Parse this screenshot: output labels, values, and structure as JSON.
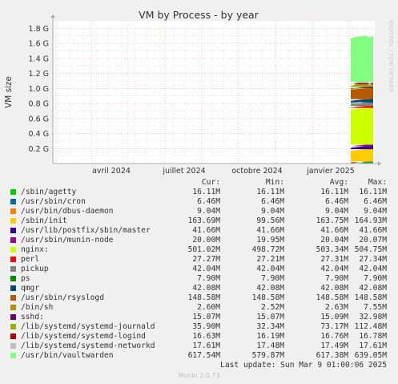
{
  "chart_data": {
    "type": "area",
    "title": "VM by Process - by year",
    "ylabel": "VM size",
    "watermark": "RRDTOOL / TOBI OETIKER",
    "x_ticks": [
      "avril 2024",
      "juillet 2024",
      "octobre 2024",
      "janvier 2025"
    ],
    "y_ticks": [
      "0.2 G",
      "0.4 G",
      "0.6 G",
      "0.8 G",
      "1.0 G",
      "1.2 G",
      "1.4 G",
      "1.6 G",
      "1.8 G"
    ],
    "ylim": [
      0,
      1.9
    ],
    "grid": true,
    "column_headers": [
      "Cur:",
      "Min:",
      "Avg:",
      "Max:"
    ],
    "series": [
      {
        "name": "/sbin/agetty",
        "color": "#00cc00",
        "cur": "16.11M",
        "min": "16.11M",
        "avg": "16.11M",
        "max": "16.11M"
      },
      {
        "name": "/usr/sbin/cron",
        "color": "#0066b3",
        "cur": "6.46M",
        "min": "6.46M",
        "avg": "6.46M",
        "max": "6.46M"
      },
      {
        "name": "/usr/bin/dbus-daemon",
        "color": "#ff8000",
        "cur": "9.04M",
        "min": "9.04M",
        "avg": "9.04M",
        "max": "9.04M"
      },
      {
        "name": "/sbin/init",
        "color": "#ffcc00",
        "cur": "163.69M",
        "min": "99.56M",
        "avg": "163.75M",
        "max": "164.93M"
      },
      {
        "name": "/usr/lib/postfix/sbin/master",
        "color": "#330099",
        "cur": "41.66M",
        "min": "41.66M",
        "avg": "41.66M",
        "max": "41.66M"
      },
      {
        "name": "/usr/sbin/munin-node",
        "color": "#990099",
        "cur": "20.00M",
        "min": "19.95M",
        "avg": "20.04M",
        "max": "20.07M"
      },
      {
        "name": "nginx:",
        "color": "#ccff00",
        "cur": "501.02M",
        "min": "498.72M",
        "avg": "503.34M",
        "max": "504.75M"
      },
      {
        "name": "perl",
        "color": "#ff0000",
        "cur": "27.27M",
        "min": "27.21M",
        "avg": "27.31M",
        "max": "27.34M"
      },
      {
        "name": "pickup",
        "color": "#808080",
        "cur": "42.04M",
        "min": "42.04M",
        "avg": "42.04M",
        "max": "42.04M"
      },
      {
        "name": "ps",
        "color": "#008f00",
        "cur": "7.90M",
        "min": "7.90M",
        "avg": "7.90M",
        "max": "7.90M"
      },
      {
        "name": "qmgr",
        "color": "#00487d",
        "cur": "42.08M",
        "min": "42.08M",
        "avg": "42.08M",
        "max": "42.08M"
      },
      {
        "name": "/usr/sbin/rsyslogd",
        "color": "#b35a00",
        "cur": "148.58M",
        "min": "148.58M",
        "avg": "148.58M",
        "max": "148.58M"
      },
      {
        "name": "/bin/sh",
        "color": "#b38f00",
        "cur": "2.60M",
        "min": "2.52M",
        "avg": "2.63M",
        "max": "7.55M"
      },
      {
        "name": "sshd:",
        "color": "#6b006b",
        "cur": "15.07M",
        "min": "15.07M",
        "avg": "15.09M",
        "max": "32.98M"
      },
      {
        "name": "/lib/systemd/systemd-journald",
        "color": "#8fb300",
        "cur": "35.90M",
        "min": "32.34M",
        "avg": "73.17M",
        "max": "112.48M"
      },
      {
        "name": "/lib/systemd/systemd-logind",
        "color": "#b30000",
        "cur": "16.63M",
        "min": "16.19M",
        "avg": "16.76M",
        "max": "16.78M"
      },
      {
        "name": "/lib/systemd/systemd-networkd",
        "color": "#bebebe",
        "cur": "17.61M",
        "min": "17.48M",
        "avg": "17.49M",
        "max": "17.61M"
      },
      {
        "name": "/usr/bin/vaultwarden",
        "color": "#80ff80",
        "cur": "617.54M",
        "min": "579.87M",
        "avg": "617.38M",
        "max": "639.05M"
      }
    ],
    "last_update": "Last update: Sun Mar  9 01:00:06 2025",
    "footer_version": "Munin 2.0.73"
  }
}
